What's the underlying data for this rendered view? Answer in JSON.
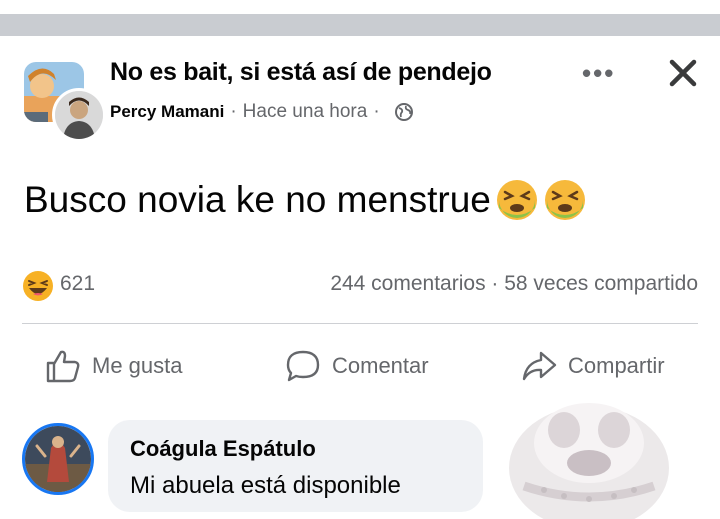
{
  "post": {
    "group_name": "No es bait, si está así de pendejo",
    "author": "Percy Mamani",
    "separator": "·",
    "time": "Hace una hora",
    "separator2": "·",
    "text": "Busco novia ke no menstrue",
    "emojis": [
      "nauseated-face",
      "nauseated-face"
    ]
  },
  "stats": {
    "reaction_icon": "laughing-face",
    "reaction_count": "621",
    "comments_shares": "244 comentarios · 58 veces compartido"
  },
  "actions": {
    "like": "Me gusta",
    "comment": "Comentar",
    "share": "Compartir"
  },
  "comment": {
    "author": "Coágula Espátulo",
    "text": "Mi abuela está disponible"
  },
  "colors": {
    "secondary_text": "#65676b",
    "comment_bubble": "#f0f2f5",
    "accent": "#1877f2"
  }
}
